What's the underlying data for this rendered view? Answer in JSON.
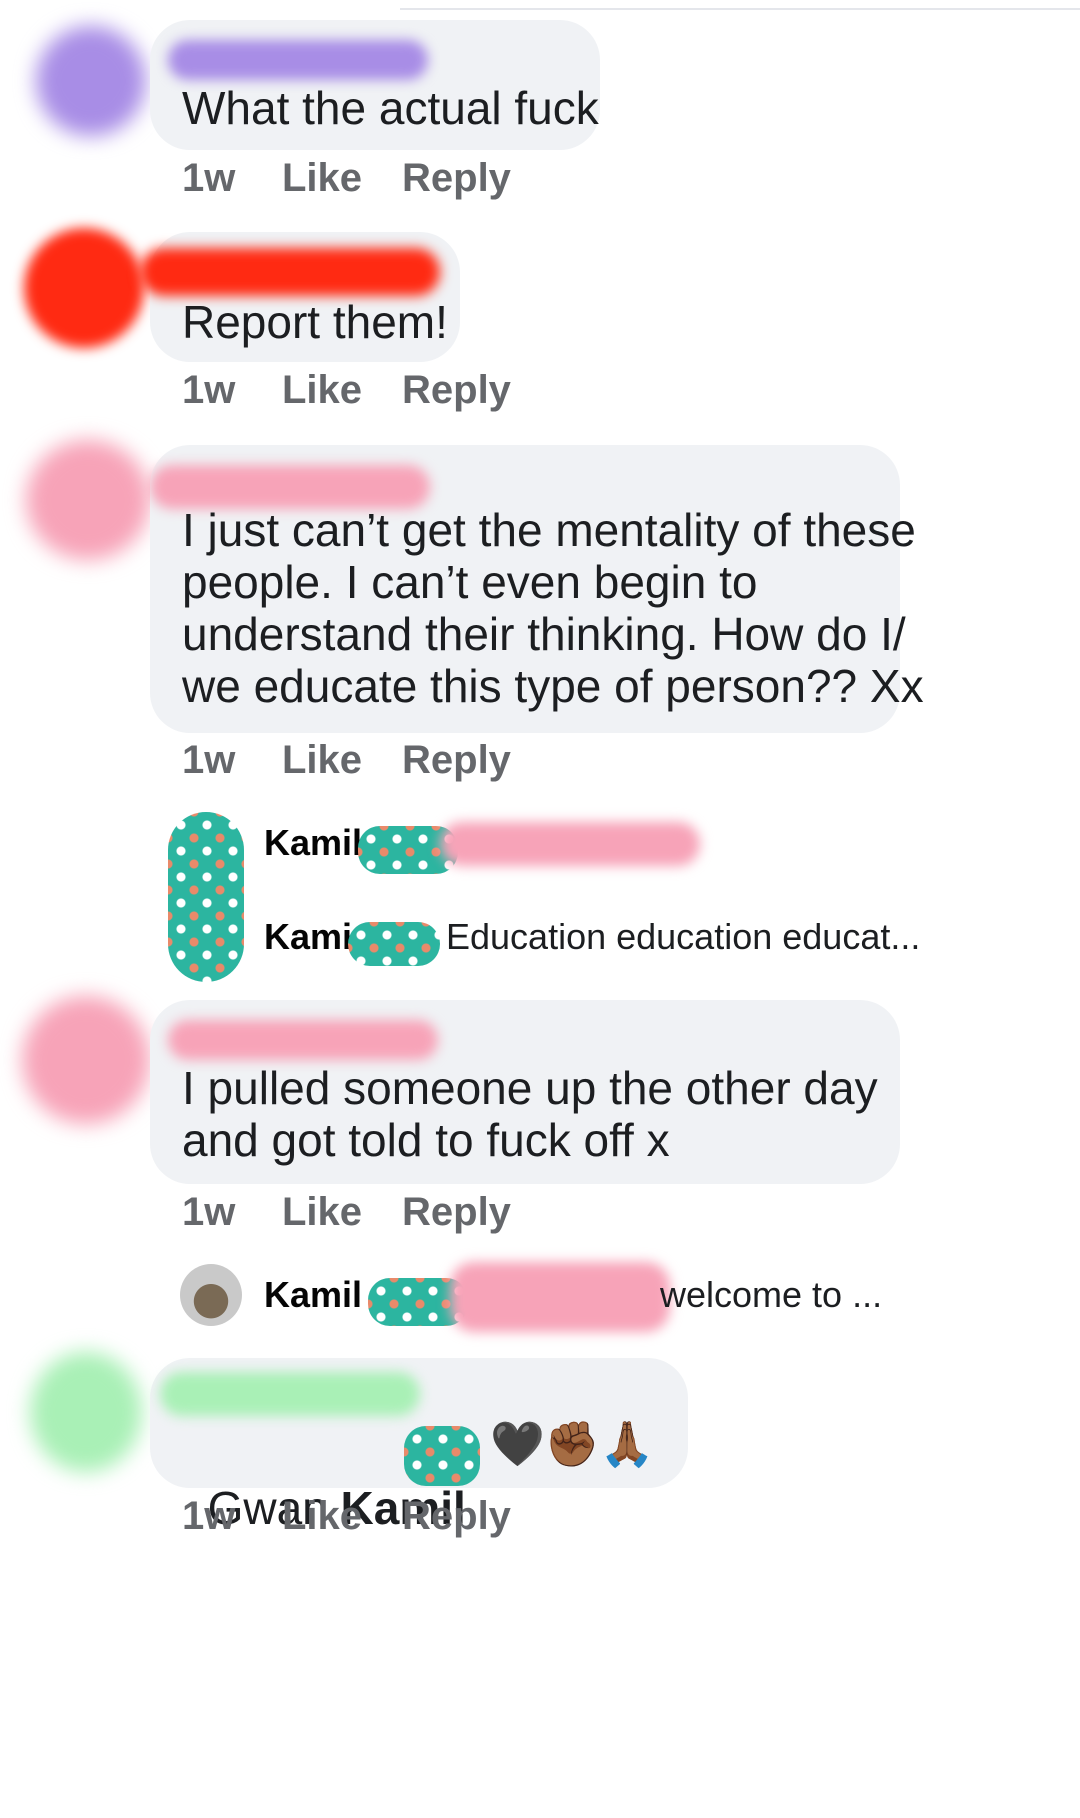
{
  "comments": [
    {
      "id": "c1",
      "text": "What the actual fuck",
      "time": "1w",
      "like": "Like",
      "reply": "Reply",
      "avatar_color": "#a88de6"
    },
    {
      "id": "c2",
      "text": "Report them!",
      "time": "1w",
      "like": "Like",
      "reply": "Reply",
      "avatar_color": "#ff2a12"
    },
    {
      "id": "c3",
      "text": "I just can’t get the mentality of these\npeople. I can’t even begin to\nunderstand their thinking. How do I/\nwe educate this type of person?? Xx",
      "time": "1w",
      "like": "Like",
      "reply": "Reply",
      "avatar_color": "#f7a3b8"
    },
    {
      "id": "c4",
      "text": "I pulled someone up the other day\nand got told to fuck off x",
      "time": "1w",
      "like": "Like",
      "reply": "Reply",
      "avatar_color": "#f7a3b8"
    },
    {
      "id": "c5",
      "text_prefix": "Gwan ",
      "text_name": "Kamil",
      "emojis": "🖤✊🏾🙏🏾",
      "time": "1w",
      "like": "Like",
      "reply": "Reply",
      "avatar_color": "#a9f0b6"
    }
  ],
  "replies": [
    {
      "name": "Kamil",
      "snippet": ""
    },
    {
      "name": "Kami",
      "snippet": "Education education educat..."
    },
    {
      "name": "Kamil",
      "snippet": "welcome to ..."
    }
  ]
}
